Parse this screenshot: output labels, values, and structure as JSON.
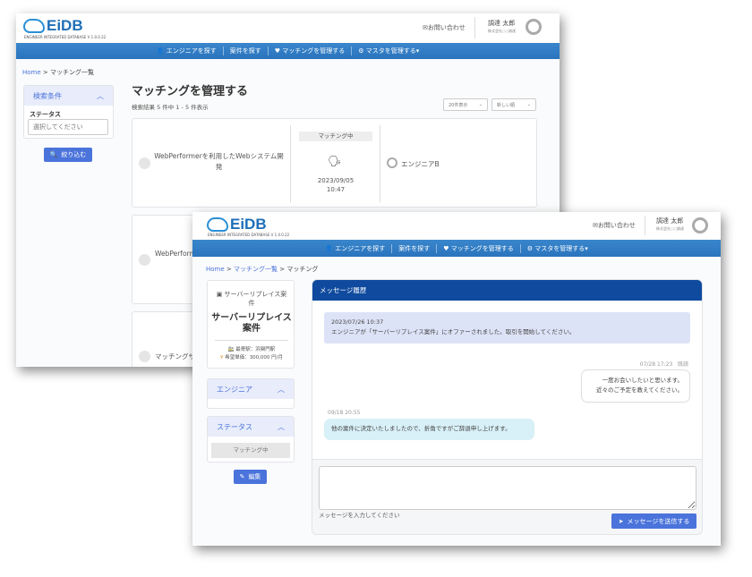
{
  "app": {
    "logo": "EiDB",
    "logo_subtitle": "ENGINEER INTEGRATED DATABASE",
    "version": "V 1.0.0.22",
    "contact": "お問い合わせ",
    "user_name": "調達 太郎",
    "user_company": "株式会社○○調達"
  },
  "nav": [
    "エンジニアを探す",
    "案件を探す",
    "マッチングを管理する",
    "マスタを管理する▾"
  ],
  "list_page": {
    "breadcrumb": [
      "Home",
      "マッチング一覧"
    ],
    "filter": {
      "title": "検索条件",
      "status_label": "ステータス",
      "status_placeholder": "選択してください",
      "button": "絞り込む"
    },
    "title": "マッチングを管理する",
    "result_count": "検索結果 5 件中 1 - 5 件表示",
    "per_page": "20件表示",
    "sort": "新しい順",
    "cards": [
      {
        "title": "WebPerformerを利用したWebシステム開発",
        "status": "マッチング中",
        "date": "2023/09/05",
        "time": "10:47",
        "engineer": "エンジニアB"
      },
      {
        "title": "WebPerform"
      },
      {
        "title": "マッチングサ"
      }
    ]
  },
  "detail_page": {
    "breadcrumb": [
      "Home",
      "マッチング一覧",
      "マッチング"
    ],
    "project": {
      "image_alt": "サーバーリプレイス案件",
      "title": "サーバーリプレイス案件",
      "station": "最寄駅：浜関門駅",
      "price": "希望単価：300,000 円/月"
    },
    "engineer_panel": "エンジニア",
    "status_panel": "ステータス",
    "status_value": "マッチング中",
    "edit_button": "編集",
    "messages_title": "メッセージ履歴",
    "messages": [
      {
        "type": "system",
        "time": "2023/07/26 10:37",
        "text": "エンジニアが「サーバーリプレイス案件」にオファーされました。取引を開始してください。"
      },
      {
        "type": "sent",
        "time": "07/28 17:23",
        "read": "既読",
        "lines": [
          "一度お会いしたいと思います。",
          "近々のご予定を教えてください。"
        ]
      },
      {
        "type": "received",
        "time": "09/18 20:55",
        "text": "他の案件に決定いたしましたので、折角ですがご辞退申し上げます。"
      }
    ],
    "input_placeholder": "メッセージを入力してください",
    "send_button": "メッセージを送信する"
  },
  "colors": {
    "nav": "#2f7bc4",
    "accent": "#4a73db",
    "panel_header": "#0f4a9e"
  }
}
